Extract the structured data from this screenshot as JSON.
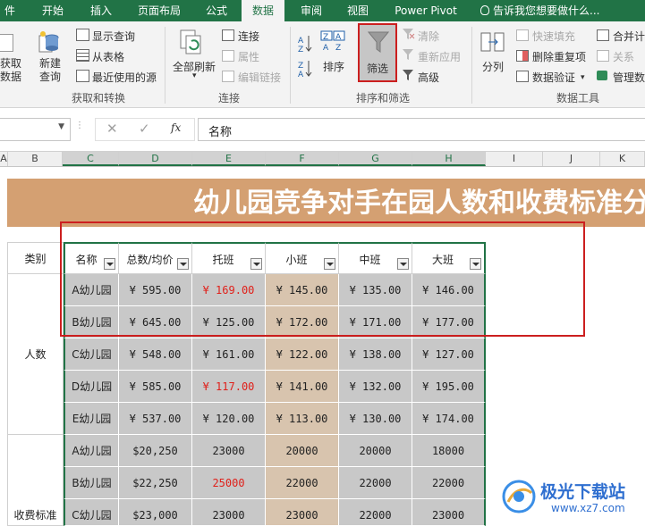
{
  "tabs": [
    "件",
    "开始",
    "插入",
    "页面布局",
    "公式",
    "数据",
    "审阅",
    "视图",
    "Power Pivot"
  ],
  "tell_me": "告诉我您想要做什么...",
  "ribbon": {
    "get_data": "获取\n数据",
    "new_query": "新建\n查询",
    "show_query": "显示查询",
    "from_table": "从表格",
    "recent_sources": "最近使用的源",
    "group_get": "获取和转换",
    "refresh_all": "全部刷新",
    "connections": "连接",
    "properties": "属性",
    "edit_links": "编辑链接",
    "group_conn": "连接",
    "sort": "排序",
    "filter": "筛选",
    "clear": "清除",
    "reapply": "重新应用",
    "advanced": "高级",
    "group_sort": "排序和筛选",
    "split": "分列",
    "flash_fill": "快速填充",
    "remove_dup": "删除重复项",
    "data_validation": "数据验证",
    "merge_calc": "合并计",
    "relations": "关系",
    "manage_model": "管理数",
    "group_tools": "数据工具"
  },
  "formula": {
    "name_box": "",
    "fx": "fx",
    "value": "名称"
  },
  "columns": [
    "A",
    "B",
    "C",
    "D",
    "E",
    "F",
    "G",
    "H",
    "I",
    "J",
    "K"
  ],
  "sheet": {
    "title": "幼儿园竞争对手在园人数和收费标准分",
    "headers": [
      "类别",
      "名称",
      "总数/均价",
      "托班",
      "小班",
      "中班",
      "大班"
    ],
    "cat_people": "人数",
    "cat_fee": "收费标准",
    "rows": [
      {
        "name": "A幼儿园",
        "total": "¥ 595.00",
        "tuo": "¥ 169.00",
        "xiao": "¥ 145.00",
        "zhong": "¥ 135.00",
        "da": "¥ 146.00"
      },
      {
        "name": "B幼儿园",
        "total": "¥ 645.00",
        "tuo": "¥ 125.00",
        "xiao": "¥ 172.00",
        "zhong": "¥ 171.00",
        "da": "¥ 177.00"
      },
      {
        "name": "C幼儿园",
        "total": "¥ 548.00",
        "tuo": "¥ 161.00",
        "xiao": "¥ 122.00",
        "zhong": "¥ 138.00",
        "da": "¥ 127.00"
      },
      {
        "name": "D幼儿园",
        "total": "¥ 585.00",
        "tuo": "¥ 117.00",
        "xiao": "¥ 141.00",
        "zhong": "¥ 132.00",
        "da": "¥ 195.00"
      },
      {
        "name": "E幼儿园",
        "total": "¥ 537.00",
        "tuo": "¥ 120.00",
        "xiao": "¥ 113.00",
        "zhong": "¥ 130.00",
        "da": "¥ 174.00"
      },
      {
        "name": "A幼儿园",
        "total": "$20,250",
        "tuo": "23000",
        "xiao": "20000",
        "zhong": "20000",
        "da": "18000"
      },
      {
        "name": "B幼儿园",
        "total": "$22,250",
        "tuo": "25000",
        "xiao": "22000",
        "zhong": "22000",
        "da": "22000"
      },
      {
        "name": "C幼儿园",
        "total": "$23,000",
        "tuo": "23000",
        "xiao": "23000",
        "zhong": "22000",
        "da": "23000"
      }
    ]
  },
  "watermark": {
    "brand": "极光下载站",
    "url": "www.xz7.com"
  },
  "colors": {
    "excel_green": "#217346",
    "title_band": "#d4a072",
    "red_text": "#e0201a",
    "highlight_box": "#cc1f1f"
  }
}
